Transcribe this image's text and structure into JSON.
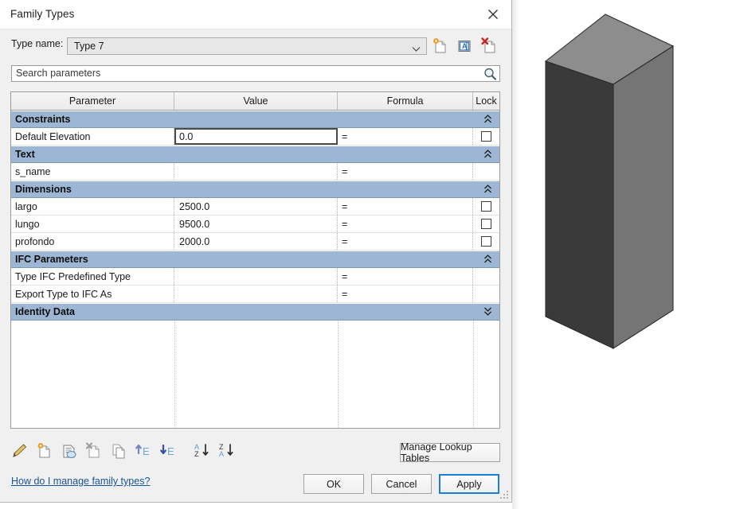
{
  "window": {
    "title": "Family Types",
    "close_icon": "close-icon"
  },
  "type_name": {
    "label": "Type name:",
    "value": "Type 7",
    "dropdown_icon": "chevron-down-icon",
    "actions": [
      {
        "name": "new-type-icon",
        "tooltip": "New Type"
      },
      {
        "name": "rename-type-icon",
        "tooltip": "Rename Type"
      },
      {
        "name": "delete-type-icon",
        "tooltip": "Delete Type"
      }
    ]
  },
  "search": {
    "placeholder": "Search parameters",
    "value": "",
    "icon": "search-icon"
  },
  "grid": {
    "columns": [
      "Parameter",
      "Value",
      "Formula",
      "Lock"
    ],
    "sections": [
      {
        "title": "Constraints",
        "state": "expanded",
        "chevron": "double-chevron-up-icon",
        "rows": [
          {
            "parameter": "Default Elevation",
            "value": "0.0",
            "formula": "=",
            "lock": false,
            "focused": true
          }
        ]
      },
      {
        "title": "Text",
        "state": "expanded",
        "chevron": "double-chevron-up-icon",
        "rows": [
          {
            "parameter": "s_name",
            "value": "",
            "formula": "=",
            "lock": null,
            "focused": false
          }
        ]
      },
      {
        "title": "Dimensions",
        "state": "expanded",
        "chevron": "double-chevron-up-icon",
        "rows": [
          {
            "parameter": "largo",
            "value": "2500.0",
            "formula": "=",
            "lock": false,
            "focused": false
          },
          {
            "parameter": "lungo",
            "value": "9500.0",
            "formula": "=",
            "lock": false,
            "focused": false
          },
          {
            "parameter": "profondo",
            "value": "2000.0",
            "formula": "=",
            "lock": false,
            "focused": false
          }
        ]
      },
      {
        "title": "IFC Parameters",
        "state": "expanded",
        "chevron": "double-chevron-up-icon",
        "rows": [
          {
            "parameter": "Type IFC Predefined Type",
            "value": "",
            "formula": "=",
            "lock": null,
            "focused": false
          },
          {
            "parameter": "Export Type to IFC As",
            "value": "",
            "formula": "=",
            "lock": null,
            "focused": false
          }
        ]
      },
      {
        "title": "Identity Data",
        "state": "collapsed",
        "chevron": "double-chevron-down-icon",
        "rows": []
      }
    ]
  },
  "toolbar": {
    "items": [
      {
        "name": "edit-parameter-icon",
        "tooltip": "Edit Parameter"
      },
      {
        "name": "new-parameter-icon",
        "tooltip": "New Parameter"
      },
      {
        "name": "new-global-parameter-icon",
        "tooltip": "New Global Parameter"
      },
      {
        "name": "remove-parameter-icon",
        "tooltip": "Remove Parameter"
      },
      {
        "name": "duplicate-parameter-icon",
        "tooltip": "Duplicate Parameter"
      },
      {
        "name": "move-parameter-up-icon",
        "tooltip": "Move Up"
      },
      {
        "name": "move-parameter-down-icon",
        "tooltip": "Move Down"
      },
      {
        "name": "sort-ascending-icon",
        "tooltip": "Sort Ascending"
      },
      {
        "name": "sort-descending-icon",
        "tooltip": "Sort Descending"
      }
    ]
  },
  "buttons": {
    "lookup": "Manage Lookup Tables",
    "ok": "OK",
    "cancel": "Cancel",
    "apply": "Apply"
  },
  "help_link": "How do I manage family types?",
  "viewport": {
    "model": "extruded-box",
    "faces": {
      "left": "#3a3a3a",
      "right": "#757575",
      "top": "#8d8d8d"
    }
  },
  "colors": {
    "section_header": "#9cb6d4",
    "accent": "#1a7fd4",
    "link": "#17559b",
    "dialog_bg": "#f0f0f0"
  }
}
